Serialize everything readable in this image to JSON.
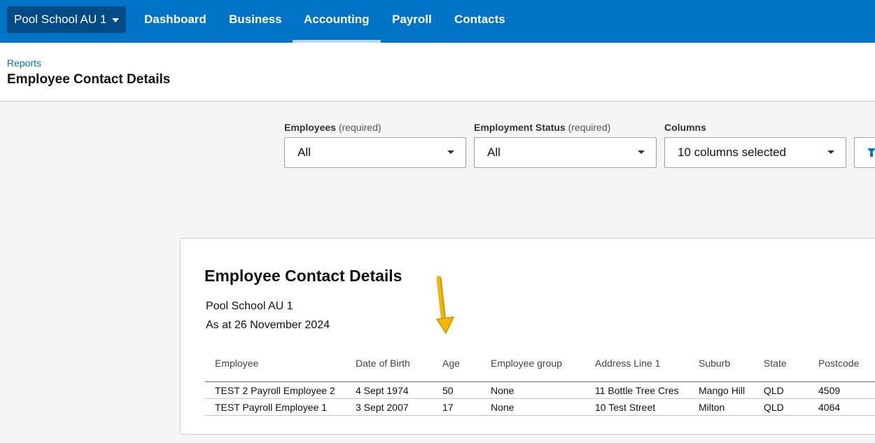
{
  "org": {
    "name": "Pool School AU 1"
  },
  "nav": {
    "items": [
      {
        "label": "Dashboard"
      },
      {
        "label": "Business"
      },
      {
        "label": "Accounting"
      },
      {
        "label": "Payroll"
      },
      {
        "label": "Contacts"
      }
    ],
    "active": "Accounting"
  },
  "header": {
    "breadcrumb": "Reports",
    "title": "Employee Contact Details"
  },
  "filters": {
    "employees": {
      "label": "Employees",
      "qualifier": "(required)",
      "value": "All"
    },
    "employment_status": {
      "label": "Employment Status",
      "qualifier": "(required)",
      "value": "All"
    },
    "columns": {
      "label": "Columns",
      "value": "10 columns selected"
    }
  },
  "report": {
    "title": "Employee Contact Details",
    "org": "Pool School AU 1",
    "date": "As at 26 November 2024",
    "columns": [
      "Employee",
      "Date of Birth",
      "Age",
      "Employee group",
      "Address Line 1",
      "Suburb",
      "State",
      "Postcode"
    ],
    "rows": [
      [
        "TEST 2 Payroll Employee 2",
        "4 Sept 1974",
        "50",
        "None",
        "11 Bottle Tree Cres",
        "Mango Hill",
        "QLD",
        "4509"
      ],
      [
        "TEST Payroll Employee 1",
        "3 Sept 2007",
        "17",
        "None",
        "10 Test Street",
        "Milton",
        "QLD",
        "4064"
      ]
    ]
  },
  "colors": {
    "brand": "#0073c7",
    "org_switcher": "#004a85",
    "annotation_arrow": "#f5b800"
  },
  "icons": {
    "org_caret": "chevron-down-icon",
    "select_caret": "caret-down-icon",
    "filter": "filter-icon",
    "annotation": "arrow-down-icon"
  }
}
